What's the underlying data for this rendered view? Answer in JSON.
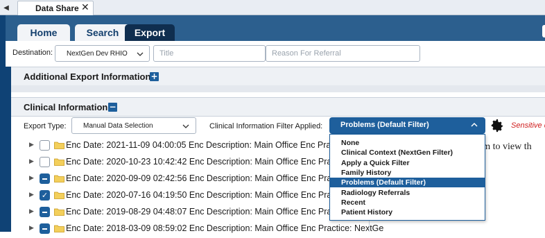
{
  "window": {
    "tab_title": "Data Share",
    "nav_arrow": "◀",
    "close_glyph": "✕"
  },
  "header": {
    "tabs": [
      {
        "label": "Home"
      },
      {
        "label": "Search"
      },
      {
        "label": "Export"
      }
    ]
  },
  "destination": {
    "label": "Destination:",
    "selected": "NextGen Dev RHIO",
    "title_placeholder": "Title",
    "reason_placeholder": "Reason For Referral"
  },
  "sections": {
    "additional": {
      "title": "Additional Export Information",
      "toggle": "+"
    },
    "clinical": {
      "title": "Clinical Information",
      "toggle": "−"
    }
  },
  "export": {
    "type_label": "Export Type:",
    "type_value": "Manual Data Selection",
    "filter_label": "Clinical Information Filter Applied:",
    "filter_value": "Problems (Default Filter)",
    "sensitive_text": "Sensitive d"
  },
  "filter_options": [
    "None",
    "Clinical Context (NextGen Filter)",
    "Apply a Quick Filter",
    "Family History",
    "Problems (Default Filter)",
    "Radiology Referrals",
    "Recent",
    "Patient History"
  ],
  "selected_option_index": 4,
  "encounters": [
    {
      "text": "Enc Date: 2021-11-09 04:00:05 Enc Description: Main Office Enc Practice",
      "state": "empty"
    },
    {
      "text": "Enc Date: 2020-10-23 10:42:42 Enc Description: Main Office Enc Practice",
      "state": "empty"
    },
    {
      "text": "Enc Date: 2020-09-09 02:42:56 Enc Description: Main Office Enc Practice",
      "state": "partial"
    },
    {
      "text": "Enc Date: 2020-07-16 04:19:50 Enc Description: Main Office Enc Practice",
      "state": "checked"
    },
    {
      "text": "Enc Date: 2019-08-29 04:48:07 Enc Description: Main Office Enc Practice",
      "state": "partial"
    },
    {
      "text": "Enc Date: 2018-03-09 08:59:02 Enc Description: Main Office Enc Practice: NextGe",
      "state": "partial"
    }
  ],
  "right_panel_fragment": "em to view th",
  "colors": {
    "header_blue": "#2c5f8e",
    "dark_navy": "#0f2e4f",
    "accent_blue": "#1e5f9c",
    "warning_red": "#d02020"
  }
}
